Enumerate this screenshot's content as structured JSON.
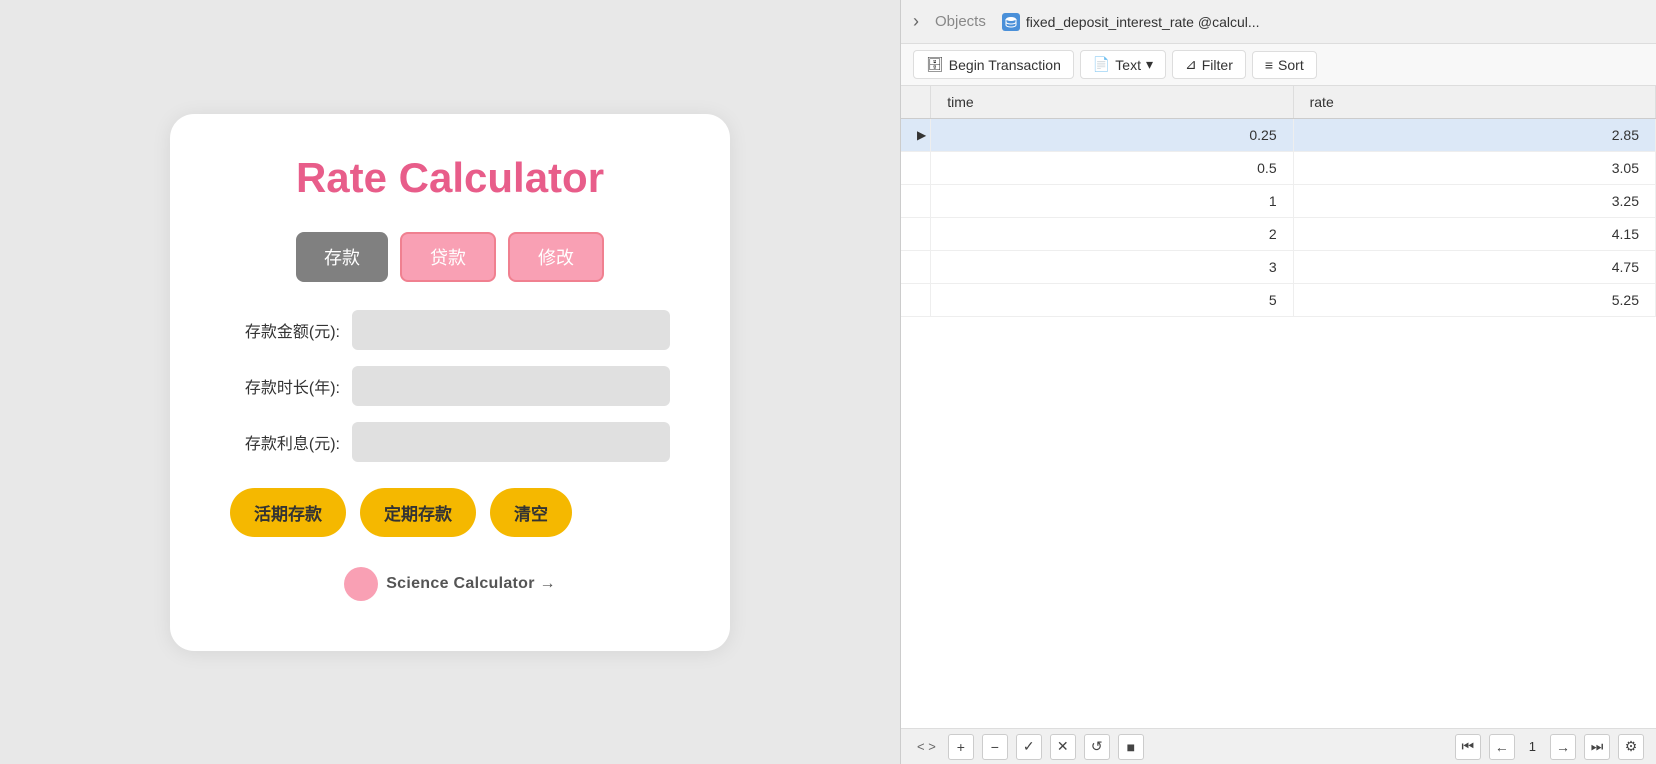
{
  "left": {
    "title": "Rate Calculator",
    "tabs": [
      {
        "label": "存款",
        "active": true
      },
      {
        "label": "贷款",
        "active": false
      },
      {
        "label": "修改",
        "active": false
      }
    ],
    "fields": [
      {
        "label": "存款金额(元):",
        "placeholder": ""
      },
      {
        "label": "存款时长(年):",
        "placeholder": ""
      },
      {
        "label": "存款利息(元):",
        "placeholder": ""
      }
    ],
    "action_buttons": [
      {
        "label": "活期存款"
      },
      {
        "label": "定期存款"
      },
      {
        "label": "清空"
      }
    ],
    "science_link": "Science Calculator →"
  },
  "right": {
    "header": {
      "chevron": "›",
      "objects_tab": "Objects",
      "db_tab_label": "fixed_deposit_interest_rate @calcul..."
    },
    "toolbar": {
      "begin_transaction": "Begin Transaction",
      "text": "Text",
      "filter": "Filter",
      "sort": "Sort"
    },
    "table": {
      "columns": [
        "time",
        "rate"
      ],
      "rows": [
        {
          "time": "0.25",
          "rate": "2.85",
          "selected": true,
          "indicator": "▶"
        },
        {
          "time": "0.5",
          "rate": "3.05",
          "selected": false,
          "indicator": ""
        },
        {
          "time": "1",
          "rate": "3.25",
          "selected": false,
          "indicator": ""
        },
        {
          "time": "2",
          "rate": "4.15",
          "selected": false,
          "indicator": ""
        },
        {
          "time": "3",
          "rate": "4.75",
          "selected": false,
          "indicator": ""
        },
        {
          "time": "5",
          "rate": "5.25",
          "selected": false,
          "indicator": ""
        }
      ]
    },
    "bottom": {
      "add": "+",
      "remove": "−",
      "check": "✓",
      "cross": "✕",
      "refresh": "↺",
      "stop": "■",
      "first": "⏮",
      "prev": "←",
      "page": "1",
      "next": "→",
      "last": "⏭",
      "gear": "⚙"
    }
  }
}
